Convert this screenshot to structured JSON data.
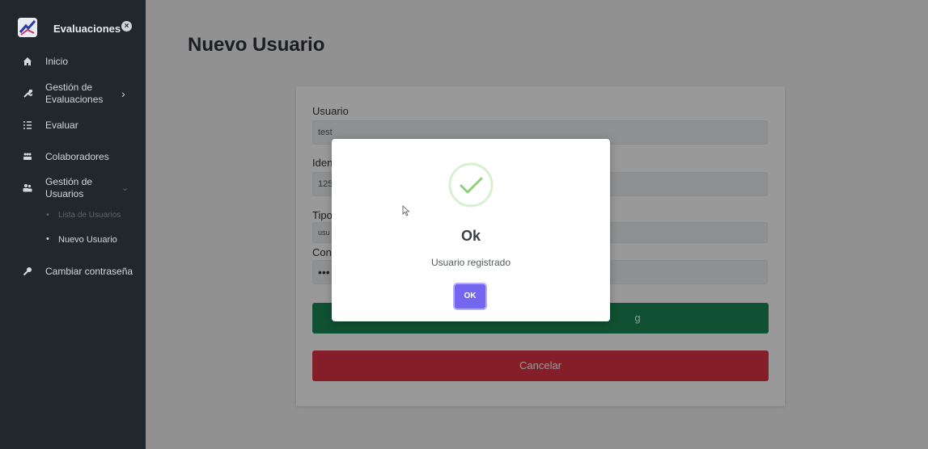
{
  "sidebar": {
    "brand": "Evaluaciones",
    "items": [
      {
        "label": "Inicio",
        "icon": "home-icon"
      },
      {
        "label": "Gestión de\nEvaluaciones",
        "icon": "wrench-icon"
      },
      {
        "label": "Evaluar",
        "icon": "list-icon"
      },
      {
        "label": "Colaboradores",
        "icon": "users-icon"
      },
      {
        "label": "Gestión de\nUsuarios",
        "icon": "user-group-icon"
      },
      {
        "label": "Cambiar contraseña",
        "icon": "key-icon"
      }
    ],
    "subitems": [
      {
        "label": "Lista de Usuarios"
      },
      {
        "label": "Nuevo Usuario"
      }
    ]
  },
  "main": {
    "page_title": "Nuevo Usuario",
    "form": {
      "usuario_label": "Usuario",
      "usuario_value": "test",
      "identificacion_label": "Iden",
      "identificacion_value": "125",
      "tipo_label": "Tipo",
      "tipo_value": "usu",
      "contrasena_label": "Cont",
      "contrasena_value": "•••",
      "submit_label": "g",
      "cancel_label": "Cancelar"
    }
  },
  "modal": {
    "title": "Ok",
    "message": "Usuario registrado",
    "ok_label": "OK"
  },
  "colors": {
    "accent": "#7367f0",
    "success": "#198754",
    "danger": "#dc3545",
    "sidebar_bg": "#22272b"
  }
}
